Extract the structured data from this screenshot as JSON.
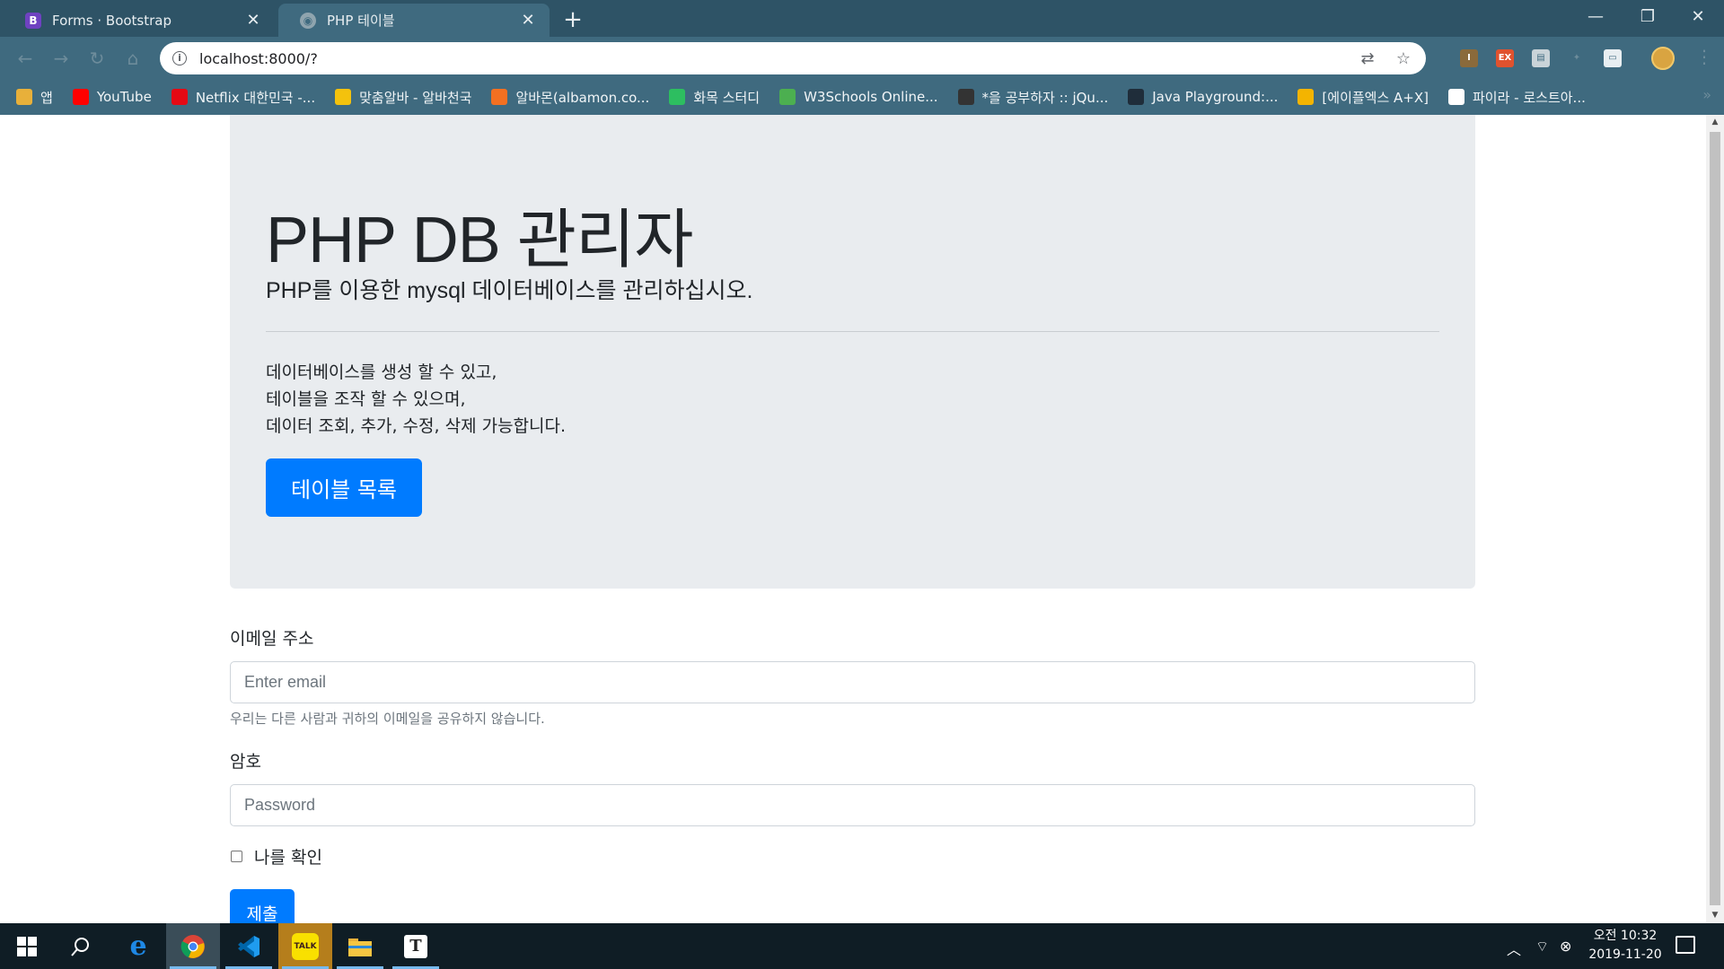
{
  "browser": {
    "tabs": [
      {
        "title": "Forms · Bootstrap",
        "favicon": "B"
      },
      {
        "title": "PHP 테이블",
        "favicon": ""
      }
    ],
    "new_tab": "+",
    "window_controls": {
      "minimize": "—",
      "restore": "❐",
      "close": "✕"
    },
    "url": "localhost:8000/?",
    "bookmarks": [
      {
        "label": "앱",
        "icon": "apps-grid-icon",
        "color": "#e8b03a"
      },
      {
        "label": "YouTube",
        "icon": "youtube-icon",
        "color": "#ff0000"
      },
      {
        "label": "Netflix 대한민국 -...",
        "icon": "netflix-icon",
        "color": "#e50914"
      },
      {
        "label": "맞춤알바 - 알바천국",
        "icon": "alba-icon",
        "color": "#f4c20d"
      },
      {
        "label": "알바몬(albamon.co...",
        "icon": "albamon-icon",
        "color": "#f37021"
      },
      {
        "label": "화목 스터디",
        "icon": "evernote-icon",
        "color": "#2dbe60"
      },
      {
        "label": "W3Schools Online...",
        "icon": "w3schools-icon",
        "color": "#4caf50"
      },
      {
        "label": "*을 공부하자 :: jQu...",
        "icon": "tistory-icon",
        "color": "#333333"
      },
      {
        "label": "Java Playground:...",
        "icon": "java-icon",
        "color": "#1f2d3a"
      },
      {
        "label": "[에이플엑스 A+X]",
        "icon": "home-icon",
        "color": "#f4b400"
      },
      {
        "label": "파이라 - 로스트아...",
        "icon": "pyra-icon",
        "color": "#ffffff"
      }
    ]
  },
  "page": {
    "jumbotron": {
      "title": "PHP DB 관리자",
      "lead": "PHP를 이용한 mysql 데이터베이스를 관리하십시오.",
      "description": [
        "데이터베이스를 생성 할 수 있고,",
        "테이블을 조작 할 수 있으며,",
        "데이터 조회, 추가, 수정, 삭제 가능합니다."
      ],
      "button_label": "테이블 목록"
    },
    "form": {
      "email_label": "이메일 주소",
      "email_placeholder": "Enter email",
      "email_help": "우리는 다른 사람과 귀하의 이메일을 공유하지 않습니다.",
      "password_label": "암호",
      "password_placeholder": "Password",
      "check_label": "나를 확인",
      "submit_label": "제출"
    }
  },
  "taskbar": {
    "apps": [
      "start-icon",
      "search-icon",
      "edge-icon",
      "chrome-icon",
      "vscode-icon",
      "kakaotalk-icon",
      "file-explorer-icon",
      "typora-icon"
    ],
    "clock": {
      "period_time": "오전 10:32",
      "date": "2019-11-20"
    }
  },
  "colors": {
    "primary": "#007bff",
    "jumbotron_bg": "#e9ecef",
    "chrome_bg": "#3f6a7f"
  }
}
